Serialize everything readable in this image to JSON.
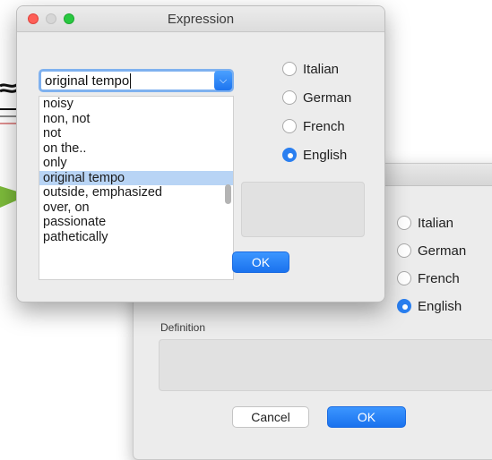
{
  "background_dialog": {
    "radios": [
      {
        "label": "Italian",
        "checked": false
      },
      {
        "label": "German",
        "checked": false
      },
      {
        "label": "French",
        "checked": false
      },
      {
        "label": "English",
        "checked": true
      }
    ],
    "definition_label": "Definition",
    "cancel_label": "Cancel",
    "ok_label": "OK"
  },
  "dialog": {
    "title": "Expression",
    "combo_value": "original tempo",
    "list_items": [
      "noisy",
      "non, not",
      "not",
      "on the..",
      "only",
      "original tempo",
      "outside, emphasized",
      "over, on",
      "passionate",
      "pathetically"
    ],
    "selected_item": "original tempo",
    "radios": [
      {
        "label": "Italian",
        "checked": false
      },
      {
        "label": "German",
        "checked": false
      },
      {
        "label": "French",
        "checked": false
      },
      {
        "label": "English",
        "checked": true
      }
    ],
    "ok_label": "OK"
  },
  "colors": {
    "accent": "#2a7ff0",
    "selection": "#b8d4f5",
    "arrow": "#7dbb3b"
  }
}
